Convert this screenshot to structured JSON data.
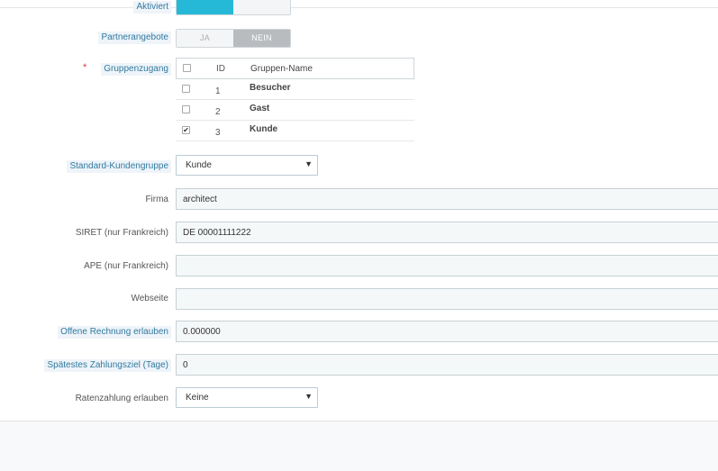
{
  "fields": {
    "aktiviert": {
      "label": "Aktiviert"
    },
    "partnerangebote": {
      "label": "Partnerangebote",
      "yes": "JA",
      "no": "NEIN"
    },
    "gruppenzugang": {
      "label": "Gruppenzugang",
      "required_mark": "*"
    },
    "standard_kundengruppe": {
      "label": "Standard-Kundengruppe",
      "value": "Kunde"
    },
    "firma": {
      "label": "Firma",
      "value": "architect"
    },
    "siret": {
      "label": "SIRET (nur Frankreich)",
      "value": "DE 00001111222"
    },
    "ape": {
      "label": "APE (nur Frankreich)",
      "value": ""
    },
    "webseite": {
      "label": "Webseite",
      "value": ""
    },
    "offene_rechnung": {
      "label": "Offene Rechnung erlauben",
      "value": "0.000000"
    },
    "zahlungsziel": {
      "label": "Spätestes Zahlungsziel (Tage)",
      "value": "0"
    },
    "ratenzahlung": {
      "label": "Ratenzahlung erlauben",
      "value": "Keine"
    }
  },
  "groups_table": {
    "headers": {
      "id": "ID",
      "name": "Gruppen-Name"
    },
    "rows": [
      {
        "id": "1",
        "name": "Besucher",
        "checked": false
      },
      {
        "id": "2",
        "name": "Gast",
        "checked": false
      },
      {
        "id": "3",
        "name": "Kunde",
        "checked": true
      }
    ]
  },
  "icons": {
    "dropdown": "caret-down-icon",
    "check": "checkmark-icon"
  },
  "colors": {
    "accent": "#25b9d7",
    "hint_text": "#32799f",
    "required": "#e0353b"
  }
}
